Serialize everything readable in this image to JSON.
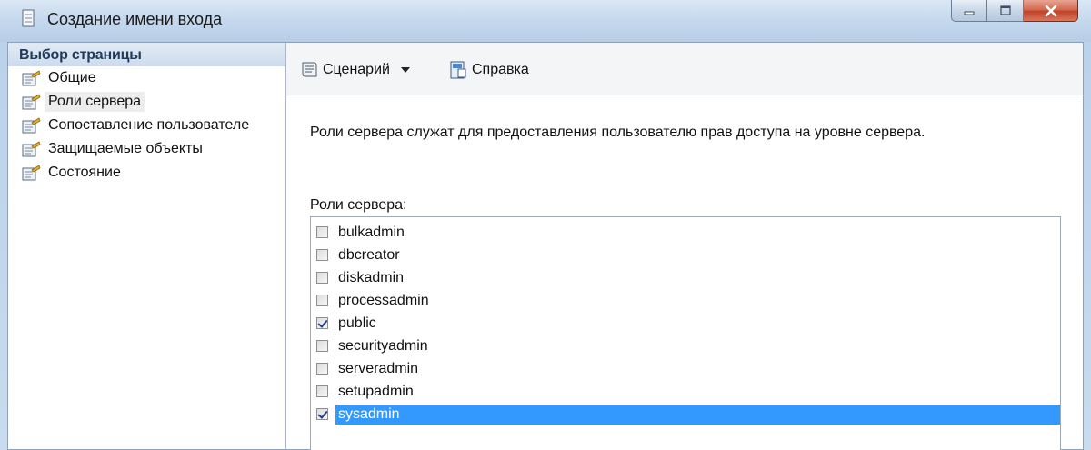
{
  "window": {
    "title": "Создание имени входа",
    "icon": "document-icon",
    "controls": [
      "minimize-icon",
      "maximize-icon",
      "close-icon"
    ]
  },
  "left_pane": {
    "header": "Выбор страницы",
    "items": [
      {
        "label": "Общие",
        "icon": "page-properties-icon",
        "selected": false
      },
      {
        "label": "Роли сервера",
        "icon": "page-properties-icon",
        "selected": true
      },
      {
        "label": "Сопоставление пользователе",
        "icon": "page-properties-icon",
        "selected": false
      },
      {
        "label": "Защищаемые объекты",
        "icon": "page-properties-icon",
        "selected": false
      },
      {
        "label": "Состояние",
        "icon": "page-properties-icon",
        "selected": false
      }
    ]
  },
  "toolbar": {
    "script_label": "Сценарий",
    "script_icon": "script-icon",
    "help_label": "Справка",
    "help_icon": "help-icon"
  },
  "content": {
    "description": "Роли сервера служат для предоставления пользователю прав доступа на уровне сервера.",
    "roles_label": "Роли сервера:",
    "roles": [
      {
        "name": "bulkadmin",
        "checked": false,
        "selected": false
      },
      {
        "name": "dbcreator",
        "checked": false,
        "selected": false
      },
      {
        "name": "diskadmin",
        "checked": false,
        "selected": false
      },
      {
        "name": "processadmin",
        "checked": false,
        "selected": false
      },
      {
        "name": "public",
        "checked": true,
        "selected": false
      },
      {
        "name": "securityadmin",
        "checked": false,
        "selected": false
      },
      {
        "name": "serveradmin",
        "checked": false,
        "selected": false
      },
      {
        "name": "setupadmin",
        "checked": false,
        "selected": false
      },
      {
        "name": "sysadmin",
        "checked": true,
        "selected": true
      }
    ]
  },
  "colors": {
    "selection": "#3399ff",
    "title_bar": "#c6d9ee",
    "close_button": "#c0432a"
  }
}
